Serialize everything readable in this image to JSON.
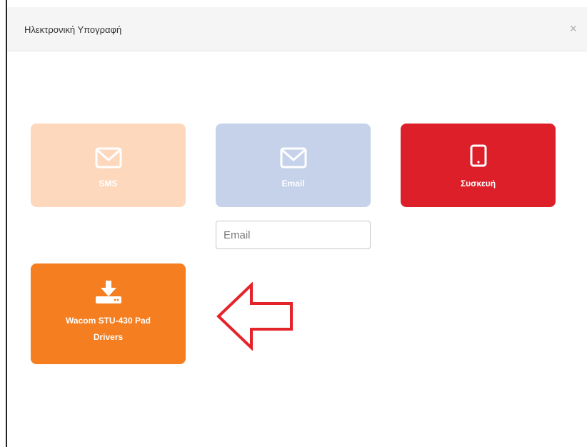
{
  "modal": {
    "title": "Ηλεκτρονική Υπογραφή",
    "close_glyph": "×"
  },
  "tiles": [
    {
      "id": "sms",
      "label": "SMS",
      "icon": "envelope-icon",
      "color": "#fdd8bd"
    },
    {
      "id": "email",
      "label": "Email",
      "icon": "envelope-icon",
      "color": "#c5d2ea"
    },
    {
      "id": "device",
      "label": "Συσκευή",
      "icon": "tablet-icon",
      "color": "#dc1f28"
    },
    {
      "id": "wacom",
      "label_line1": "Wacom STU-430 Pad",
      "label_line2": "Drivers",
      "icon": "download-icon",
      "color": "#f47e20"
    }
  ],
  "email_field": {
    "value": "",
    "placeholder": "Email"
  },
  "annotation": {
    "icon": "left-arrow-icon",
    "color": "#e5232a"
  }
}
